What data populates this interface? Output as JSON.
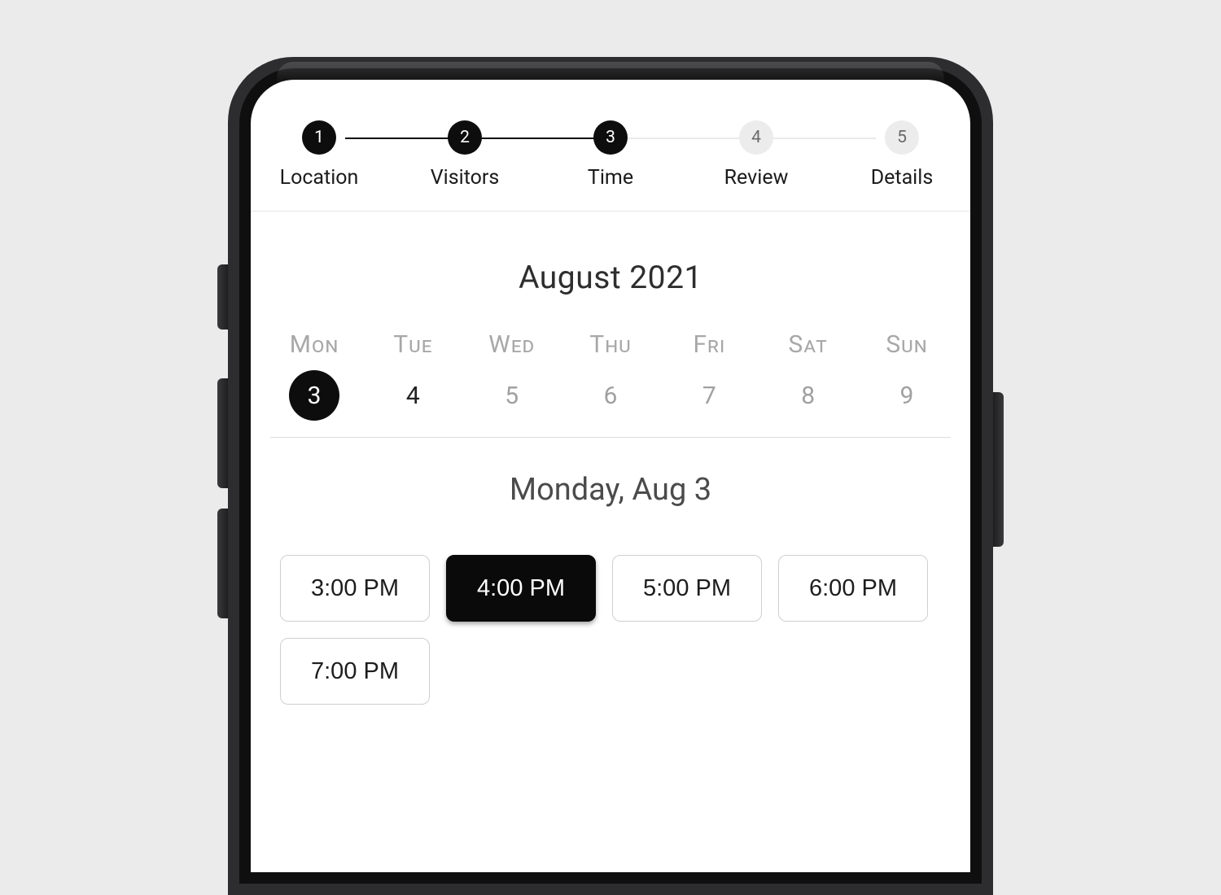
{
  "stepper": {
    "steps": [
      {
        "num": "1",
        "label": "Location",
        "state": "done"
      },
      {
        "num": "2",
        "label": "Visitors",
        "state": "done"
      },
      {
        "num": "3",
        "label": "Time",
        "state": "done"
      },
      {
        "num": "4",
        "label": "Review",
        "state": "todo"
      },
      {
        "num": "5",
        "label": "Details",
        "state": "todo"
      }
    ]
  },
  "calendar": {
    "month_label": "August 2021",
    "days": [
      {
        "dow": "Mon",
        "num": "3",
        "state": "selected"
      },
      {
        "dow": "Tue",
        "num": "4",
        "state": "active"
      },
      {
        "dow": "Wed",
        "num": "5",
        "state": "muted"
      },
      {
        "dow": "Thu",
        "num": "6",
        "state": "muted"
      },
      {
        "dow": "Fri",
        "num": "7",
        "state": "muted"
      },
      {
        "dow": "Sat",
        "num": "8",
        "state": "muted"
      },
      {
        "dow": "Sun",
        "num": "9",
        "state": "muted"
      }
    ],
    "selected_date_label": "Monday, Aug 3"
  },
  "slots": [
    {
      "label": "3:00 PM",
      "selected": false
    },
    {
      "label": "4:00 PM",
      "selected": true
    },
    {
      "label": "5:00 PM",
      "selected": false
    },
    {
      "label": "6:00 PM",
      "selected": false
    },
    {
      "label": "7:00 PM",
      "selected": false
    }
  ]
}
